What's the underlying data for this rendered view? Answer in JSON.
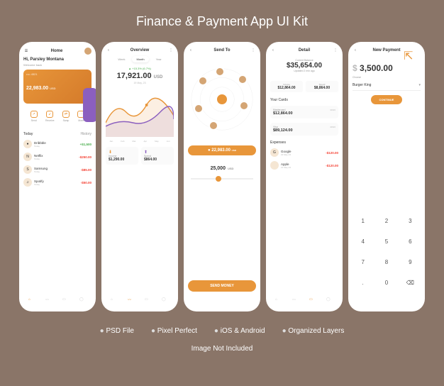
{
  "title": "Finance & Payment App UI Kit",
  "features": [
    "PSD File",
    "Pixel Perfect",
    "iOS & Android",
    "Organized Layers"
  ],
  "note": "Image Not Included",
  "colors": {
    "accent": "#e8963a",
    "pos": "#4caf50",
    "neg": "#f44336"
  },
  "home": {
    "title": "Home",
    "greeting": "Hi, Parsley Montana",
    "sub": "Welcome back",
    "balance": "22,983.00",
    "currency": "USD",
    "actions": [
      {
        "icon": "↗",
        "label": "Send"
      },
      {
        "icon": "↙",
        "label": "Receive"
      },
      {
        "icon": "⇄",
        "label": "Swap"
      },
      {
        "icon": "⋯",
        "label": "More"
      }
    ],
    "today": "Today",
    "history": "History",
    "tx": [
      {
        "name": "Dribbble",
        "date": "Today",
        "amt": "+$1,500",
        "cls": "pos"
      },
      {
        "name": "Netflix",
        "date": "Today",
        "amt": "-$250.00",
        "cls": "neg"
      },
      {
        "name": "Samsung",
        "date": "Today",
        "amt": "-$85.00",
        "cls": "neg"
      },
      {
        "name": "Spotify",
        "date": "Today",
        "amt": "-$50.00",
        "cls": "neg"
      }
    ]
  },
  "overview": {
    "title": "Overview",
    "tabs": [
      "Week",
      "Month",
      "Year"
    ],
    "activeTab": "Month",
    "change": "▲ +15.3% (6.7%)",
    "value": "17,921.00",
    "valueDec": "USD",
    "date": "19 May, 23",
    "months": [
      "Jan",
      "Feb",
      "Mar",
      "Apr",
      "May",
      "Jun"
    ],
    "stats": [
      {
        "label": "Income",
        "val": "$1,290.00",
        "icon": "↓"
      },
      {
        "label": "Spend",
        "val": "$864.00",
        "icon": "↑"
      }
    ]
  },
  "sendTo": {
    "title": "Send To",
    "pill": "22,983.00",
    "pillSub": "USD",
    "amount": "25,000",
    "amountSub": "USD",
    "btn": "SEND MONEY"
  },
  "detail": {
    "title": "Detail",
    "balLabel": "Current Balance",
    "balance": "$35,654.00",
    "balSub": "Updated 2 min ago",
    "split": [
      {
        "label": "Income",
        "val": "$12,864.00"
      },
      {
        "label": "Spend",
        "val": "$8,864.00"
      }
    ],
    "cardsHdr": "Your Cards",
    "cards": [
      {
        "name": "Mastercard",
        "val": "$12,864.00",
        "exp": "08/26"
      },
      {
        "name": "Visa",
        "val": "$89,124.00",
        "exp": "08/26"
      }
    ],
    "expHdr": "Expenses",
    "expenses": [
      {
        "name": "Google",
        "date": "22 May 23",
        "amt": "-$120.00",
        "cls": "neg"
      },
      {
        "name": "Apple",
        "date": "21 May 23",
        "amt": "-$120.00",
        "cls": "neg"
      }
    ]
  },
  "newPayment": {
    "title": "New Payment",
    "amount": "3,500.00",
    "currency": "$",
    "chooseLabel": "Choose",
    "merchant": "Burger King",
    "continue": "CONTINUE",
    "keys": [
      "1",
      "2",
      "3",
      "4",
      "5",
      "6",
      "7",
      "8",
      "9",
      ".",
      "0",
      "⌫"
    ]
  }
}
